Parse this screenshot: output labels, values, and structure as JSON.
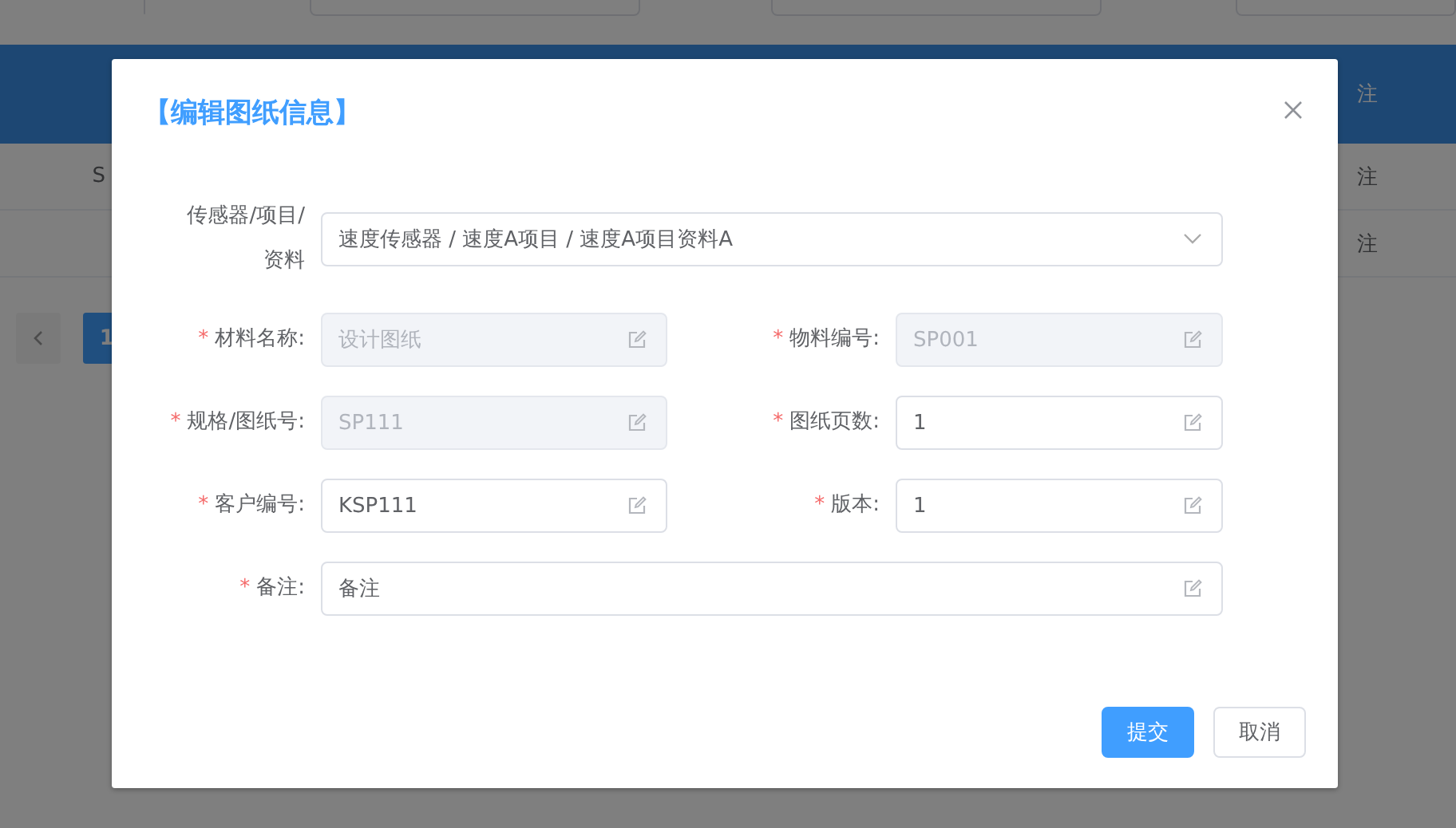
{
  "background": {
    "table": {
      "header": [
        "注"
      ],
      "rows": [
        {
          "first": "S",
          "last": "注"
        },
        {
          "first": "",
          "last": "注"
        }
      ]
    },
    "pagination": {
      "pages": [
        {
          "label": "1",
          "selected": true
        }
      ]
    }
  },
  "dialog": {
    "title": "【编辑图纸信息】",
    "rows": [
      [
        {
          "kind": "select",
          "label": "传感器/项目/资料",
          "value": "速度传感器 / 速度A项目 / 速度A项目资料A"
        }
      ],
      [
        {
          "kind": "input",
          "mark": "*",
          "label": "材料名称:",
          "value": "设计图纸",
          "disabled": true
        },
        {
          "kind": "input",
          "mark": "*",
          "label": "物料编号:",
          "value": "SP001",
          "disabled": true
        }
      ],
      [
        {
          "kind": "input",
          "mark": "*",
          "label": "规格/图纸号:",
          "value": "SP111",
          "disabled": true
        },
        {
          "kind": "input",
          "mark": "*",
          "label": "图纸页数:",
          "value": "1",
          "disabled": false
        }
      ],
      [
        {
          "kind": "input",
          "mark": "*",
          "label": "客户编号:",
          "value": "KSP111",
          "disabled": false
        },
        {
          "kind": "input",
          "mark": "*",
          "label": "版本:",
          "value": "1",
          "disabled": false
        }
      ],
      [
        {
          "kind": "input",
          "mark": "*",
          "label": "备注:",
          "value": "备注",
          "disabled": false
        }
      ]
    ],
    "buttons": [
      {
        "label": "提交",
        "kind": "primary"
      },
      {
        "label": "取消",
        "kind": "default"
      }
    ]
  }
}
